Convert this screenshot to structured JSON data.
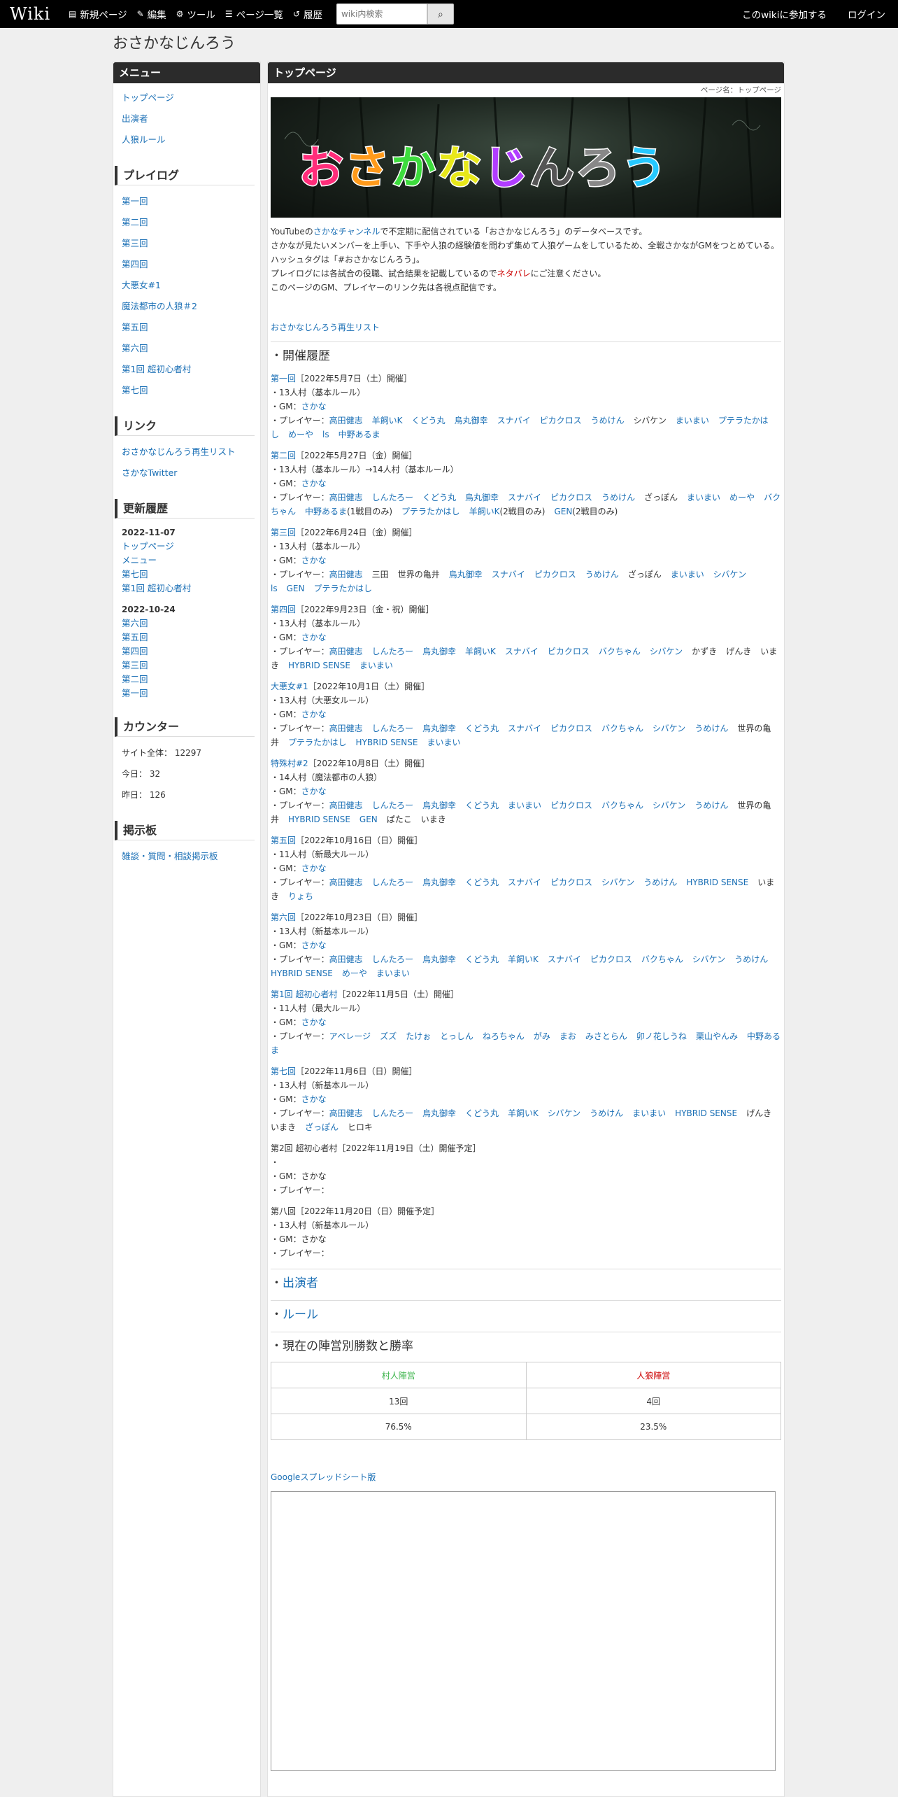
{
  "topbar": {
    "logo": "Wiki",
    "nav": [
      {
        "icon": "file-icon",
        "glyph": "▤",
        "label": "新規ページ"
      },
      {
        "icon": "edit-icon",
        "glyph": "✎",
        "label": "編集"
      },
      {
        "icon": "gear-icon",
        "glyph": "⚙",
        "label": "ツール"
      },
      {
        "icon": "list-icon",
        "glyph": "☰",
        "label": "ページ一覧"
      },
      {
        "icon": "history-icon",
        "glyph": "↺",
        "label": "履歴"
      }
    ],
    "search_placeholder": "wiki内検索",
    "join": "このwikiに参加する",
    "login": "ログイン"
  },
  "site_title": "おさかなじんろう",
  "sidebar": {
    "menu_title": "メニュー",
    "menu": [
      "トップページ",
      "出演者",
      "人狼ルール"
    ],
    "playlog_title": "プレイログ",
    "playlog": [
      "第一回",
      "第二回",
      "第三回",
      "第四回",
      "大悪女#1",
      "魔法都市の人狼＃2",
      "第五回",
      "第六回",
      "第1回 超初心者村",
      "第七回"
    ],
    "links_title": "リンク",
    "links": [
      "おさかなじんろう再生リスト",
      "さかなTwitter"
    ],
    "updates_title": "更新履歴",
    "updates": [
      {
        "date": "2022-11-07",
        "pages": [
          "トップページ",
          "メニュー",
          "第七回",
          "第1回 超初心者村"
        ]
      },
      {
        "date": "2022-10-24",
        "pages": [
          "第六回",
          "第五回",
          "第四回",
          "第三回",
          "第二回",
          "第一回"
        ]
      }
    ],
    "counter_title": "カウンター",
    "counter": [
      "サイト全体： 12297",
      "今日： 32",
      "昨日： 126"
    ],
    "bbs_title": "掲示板",
    "bbs": "雑談・質問・相談掲示板"
  },
  "main": {
    "title": "トップページ",
    "page_name": "ページ名：トップページ",
    "banner_text": "おさかなじんろう",
    "intro1_pre": "YouTubeの",
    "intro1_link": "さかなチャンネル",
    "intro1_post": "で不定期に配信されている「おさかなじんろう」のデータベースです。",
    "intro2": "さかなが見たいメンバーを上手い、下手や人狼の経験値を問わず集めて人狼ゲームをしているため、全戦さかながGMをつとめている。",
    "intro3": "ハッシュタグは「#おさかなじんろう」。",
    "intro4_pre": "プレイログには各試合の役職、試合結果を記載しているので",
    "intro4_red": "ネタバレ",
    "intro4_post": "にご注意ください。",
    "intro5": "このページのGM、プレイヤーのリンク先は各視点配信です。",
    "playlist_link": "おさかなじんろう再生リスト",
    "history_heading": "・開催履歴",
    "events": [
      {
        "title": "第一回",
        "link": true,
        "date": "［2022年5月7日（土）開催］",
        "lines": [
          "・13人村（基本ルール）"
        ],
        "gm": "さかな",
        "gm_link": true,
        "players": [
          [
            "高田健志",
            1
          ],
          [
            "羊飼いK",
            1
          ],
          [
            "くどう丸",
            1
          ],
          [
            "烏丸御幸",
            1
          ],
          [
            "スナバイ",
            1
          ],
          [
            "ピカクロス",
            1
          ],
          [
            "うめけん",
            1
          ],
          [
            "シバケン",
            0
          ],
          [
            "まいまい",
            1
          ],
          [
            "プテラたかはし",
            1
          ],
          [
            "めーや",
            1
          ],
          [
            "ls",
            1
          ],
          [
            "中野あるま",
            1
          ]
        ]
      },
      {
        "title": "第二回",
        "link": true,
        "date": "［2022年5月27日（金）開催］",
        "lines": [
          "・13人村（基本ルール）→14人村（基本ルール）"
        ],
        "gm": "さかな",
        "gm_link": true,
        "players": [
          [
            "高田健志",
            1
          ],
          [
            "しんたろー",
            1
          ],
          [
            "くどう丸",
            1
          ],
          [
            "烏丸御幸",
            1
          ],
          [
            "スナバイ",
            1
          ],
          [
            "ピカクロス",
            1
          ],
          [
            "うめけん",
            1
          ],
          [
            "ざっぽん",
            0
          ],
          [
            "まいまい",
            1
          ],
          [
            "めーや",
            1
          ],
          [
            "バクちゃん",
            1
          ],
          [
            "中野あるま",
            1
          ],
          [
            "(1戦目のみ)",
            0
          ],
          [
            "プテラたかはし",
            1
          ],
          [
            "羊飼いK",
            1
          ],
          [
            "(2戦目のみ)",
            0
          ],
          [
            "GEN",
            1
          ],
          [
            "(2戦目のみ)",
            0
          ]
        ]
      },
      {
        "title": "第三回",
        "link": true,
        "date": "［2022年6月24日（金）開催］",
        "lines": [
          "・13人村（基本ルール）"
        ],
        "gm": "さかな",
        "gm_link": true,
        "players": [
          [
            "高田健志",
            1
          ],
          [
            "三田",
            0
          ],
          [
            "世界の亀井",
            0
          ],
          [
            "烏丸御幸",
            1
          ],
          [
            "スナバイ",
            1
          ],
          [
            "ピカクロス",
            1
          ],
          [
            "うめけん",
            1
          ],
          [
            "ざっぽん",
            0
          ],
          [
            "まいまい",
            1
          ],
          [
            "シバケン",
            1
          ],
          [
            "ls",
            1
          ],
          [
            "GEN",
            1
          ],
          [
            "プテラたかはし",
            1
          ]
        ]
      },
      {
        "title": "第四回",
        "link": true,
        "date": "［2022年9月23日（金・祝）開催］",
        "lines": [
          "・13人村（基本ルール）"
        ],
        "gm": "さかな",
        "gm_link": true,
        "players": [
          [
            "高田健志",
            1
          ],
          [
            "しんたろー",
            1
          ],
          [
            "烏丸御幸",
            1
          ],
          [
            "羊飼いK",
            1
          ],
          [
            "スナバイ",
            1
          ],
          [
            "ピカクロス",
            1
          ],
          [
            "バクちゃん",
            1
          ],
          [
            "シバケン",
            1
          ],
          [
            "かずき",
            0
          ],
          [
            "げんき",
            0
          ],
          [
            "いまき",
            0
          ],
          [
            "HYBRID SENSE",
            1
          ],
          [
            "まいまい",
            1
          ]
        ]
      },
      {
        "title": "大悪女#1",
        "link": true,
        "date": "［2022年10月1日（土）開催］",
        "lines": [
          "・13人村（大悪女ルール）"
        ],
        "gm": "さかな",
        "gm_link": true,
        "players": [
          [
            "高田健志",
            1
          ],
          [
            "しんたろー",
            1
          ],
          [
            "烏丸御幸",
            1
          ],
          [
            "くどう丸",
            1
          ],
          [
            "スナバイ",
            1
          ],
          [
            "ピカクロス",
            1
          ],
          [
            "バクちゃん",
            1
          ],
          [
            "シバケン",
            1
          ],
          [
            "うめけん",
            1
          ],
          [
            "世界の亀井",
            0
          ],
          [
            "プテラたかはし",
            1
          ],
          [
            "HYBRID SENSE",
            1
          ],
          [
            "まいまい",
            1
          ]
        ]
      },
      {
        "title": "特殊村#2",
        "link": true,
        "date": "［2022年10月8日（土）開催］",
        "lines": [
          "・14人村（魔法都市の人狼）"
        ],
        "gm": "さかな",
        "gm_link": true,
        "players": [
          [
            "高田健志",
            1
          ],
          [
            "しんたろー",
            1
          ],
          [
            "烏丸御幸",
            1
          ],
          [
            "くどう丸",
            1
          ],
          [
            "まいまい",
            1
          ],
          [
            "ピカクロス",
            1
          ],
          [
            "バクちゃん",
            1
          ],
          [
            "シバケン",
            1
          ],
          [
            "うめけん",
            1
          ],
          [
            "世界の亀井",
            0
          ],
          [
            "HYBRID SENSE",
            1
          ],
          [
            "GEN",
            1
          ],
          [
            "ぱたこ",
            0
          ],
          [
            "いまき",
            0
          ]
        ]
      },
      {
        "title": "第五回",
        "link": true,
        "date": "［2022年10月16日（日）開催］",
        "lines": [
          "・11人村（新最大ルール）"
        ],
        "gm": "さかな",
        "gm_link": true,
        "players": [
          [
            "高田健志",
            1
          ],
          [
            "しんたろー",
            1
          ],
          [
            "烏丸御幸",
            1
          ],
          [
            "くどう丸",
            1
          ],
          [
            "スナバイ",
            1
          ],
          [
            "ピカクロス",
            1
          ],
          [
            "シバケン",
            1
          ],
          [
            "うめけん",
            1
          ],
          [
            "HYBRID SENSE",
            1
          ],
          [
            "いまき",
            0
          ],
          [
            "りょち",
            1
          ]
        ]
      },
      {
        "title": "第六回",
        "link": true,
        "date": "［2022年10月23日（日）開催］",
        "lines": [
          "・13人村（新基本ルール）"
        ],
        "gm": "さかな",
        "gm_link": true,
        "players": [
          [
            "高田健志",
            1
          ],
          [
            "しんたろー",
            1
          ],
          [
            "烏丸御幸",
            1
          ],
          [
            "くどう丸",
            1
          ],
          [
            "羊飼いK",
            1
          ],
          [
            "スナバイ",
            1
          ],
          [
            "ピカクロス",
            1
          ],
          [
            "バクちゃん",
            1
          ],
          [
            "シバケン",
            1
          ],
          [
            "うめけん",
            1
          ],
          [
            "HYBRID SENSE",
            1
          ],
          [
            "めーや",
            1
          ],
          [
            "まいまい",
            1
          ]
        ]
      },
      {
        "title": "第1回 超初心者村",
        "link": true,
        "date": "［2022年11月5日（土）開催］",
        "lines": [
          "・11人村（最大ルール）"
        ],
        "gm": "さかな",
        "gm_link": true,
        "players": [
          [
            "アベレージ",
            1
          ],
          [
            "ズズ",
            1
          ],
          [
            "たけぉ",
            1
          ],
          [
            "とっしん",
            1
          ],
          [
            "ねろちゃん",
            1
          ],
          [
            "がみ",
            1
          ],
          [
            "まお",
            1
          ],
          [
            "みさとらん",
            1
          ],
          [
            "卯ノ花しうね",
            1
          ],
          [
            "栗山やんみ",
            1
          ],
          [
            "中野あるま",
            1
          ]
        ]
      },
      {
        "title": "第七回",
        "link": true,
        "date": "［2022年11月6日（日）開催］",
        "lines": [
          "・13人村（新基本ルール）"
        ],
        "gm": "さかな",
        "gm_link": true,
        "players": [
          [
            "高田健志",
            1
          ],
          [
            "しんたろー",
            1
          ],
          [
            "烏丸御幸",
            1
          ],
          [
            "くどう丸",
            1
          ],
          [
            "羊飼いK",
            1
          ],
          [
            "シバケン",
            1
          ],
          [
            "うめけん",
            1
          ],
          [
            "まいまい",
            1
          ],
          [
            "HYBRID SENSE",
            1
          ],
          [
            "げんき",
            0
          ],
          [
            "いまき",
            0
          ],
          [
            "ざっぽん",
            1
          ],
          [
            "ヒロキ",
            0
          ]
        ]
      },
      {
        "title": "第2回 超初心者村",
        "link": false,
        "date": "［2022年11月19日（土）開催予定］",
        "lines": [
          "・"
        ],
        "gm": "さかな",
        "gm_link": false,
        "players": []
      },
      {
        "title": "第八回",
        "link": false,
        "date": "［2022年11月20日（日）開催予定］",
        "lines": [
          "・13人村（新基本ルール）"
        ],
        "gm": "さかな",
        "gm_link": false,
        "players": []
      }
    ],
    "gm_prefix": "・GM：",
    "players_prefix": "・プレイヤー：",
    "cast_heading_dot": "・",
    "cast_heading": "出演者",
    "rules_heading_dot": "・",
    "rules_heading": "ルール",
    "stats_heading": "・現在の陣営別勝数と勝率",
    "stats": {
      "headers": [
        "村人陣営",
        "人狼陣営"
      ],
      "wins": [
        "13回",
        "4回"
      ],
      "rates": [
        "76.5%",
        "23.5%"
      ],
      "colors": {
        "village": "#3cb44b",
        "wolf": "#cc0000"
      }
    },
    "sheet_link": "Googleスプレッドシート版"
  }
}
